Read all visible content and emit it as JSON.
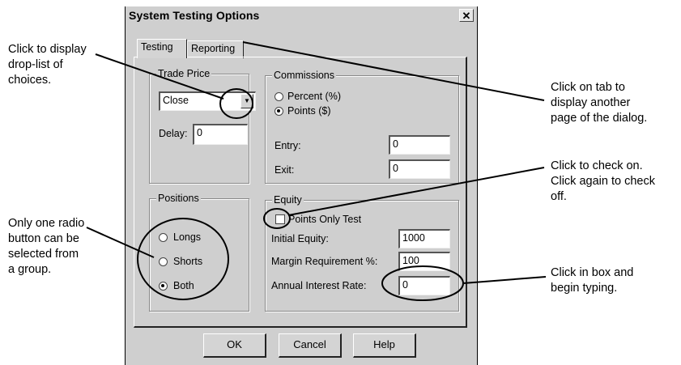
{
  "dialog": {
    "title": "System Testing Options",
    "close_glyph": "✕",
    "tabs": [
      {
        "label": "Testing",
        "active": true
      },
      {
        "label": "Reporting",
        "active": false
      }
    ],
    "trade_price": {
      "group_label": "Trade Price",
      "selected_value": "Close",
      "delay_label": "Delay:",
      "delay_value": "0"
    },
    "commissions": {
      "group_label": "Commissions",
      "options": [
        {
          "label": "Percent (%)",
          "selected": false
        },
        {
          "label": "Points ($)",
          "selected": true
        }
      ],
      "entry_label": "Entry:",
      "entry_value": "0",
      "exit_label": "Exit:",
      "exit_value": "0"
    },
    "positions": {
      "group_label": "Positions",
      "options": [
        {
          "label": "Longs",
          "selected": false
        },
        {
          "label": "Shorts",
          "selected": false
        },
        {
          "label": "Both",
          "selected": true
        }
      ]
    },
    "equity": {
      "group_label": "Equity",
      "points_only_label": "Points Only Test",
      "points_only_checked": false,
      "initial_equity_label": "Initial Equity:",
      "initial_equity_value": "1000",
      "margin_label": "Margin Requirement %:",
      "margin_value": "100",
      "interest_label": "Annual Interest Rate:",
      "interest_value": "0"
    },
    "buttons": {
      "ok": "OK",
      "cancel": "Cancel",
      "help": "Help"
    }
  },
  "annotations": {
    "droplist": "Click to display\ndrop-list of\nchoices.",
    "tab": "Click on tab to\ndisplay another\npage of the dialog.",
    "checkbox": "Click to check on.\nClick again to check\noff.",
    "radio": "Only one radio\nbutton can be\nselected from\na group.",
    "textbox": "Click in box and\nbegin typing."
  },
  "icons": {
    "dropdown": "chevron-down-icon",
    "close": "close-icon"
  }
}
